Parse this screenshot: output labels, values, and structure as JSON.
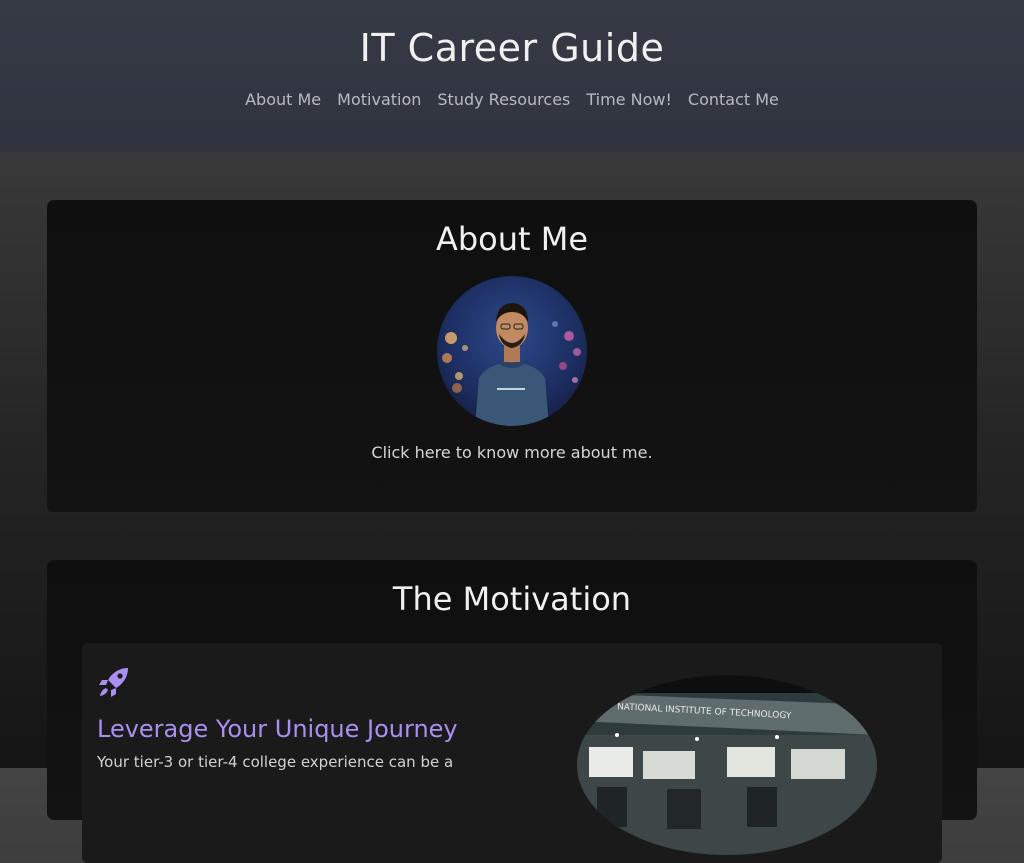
{
  "header": {
    "title": "IT Career Guide",
    "nav": [
      {
        "label": "About Me"
      },
      {
        "label": "Motivation"
      },
      {
        "label": "Study Resources"
      },
      {
        "label": "Time Now!"
      },
      {
        "label": "Contact Me"
      }
    ]
  },
  "about": {
    "title": "About Me",
    "avatar_icon": "profile-photo",
    "link_text": "Click here to know more about me."
  },
  "motivation": {
    "title": "The Motivation",
    "card": {
      "icon": "rocket-icon",
      "heading": "Leverage Your Unique Journey",
      "text": "Your tier-3 or tier-4 college experience can be a",
      "photo_caption": "NATIONAL INSTITUTE OF TECHNOLOGY"
    }
  },
  "colors": {
    "accent": "#a98ff0",
    "header_bg": "#353944",
    "card_bg": "#111111"
  }
}
